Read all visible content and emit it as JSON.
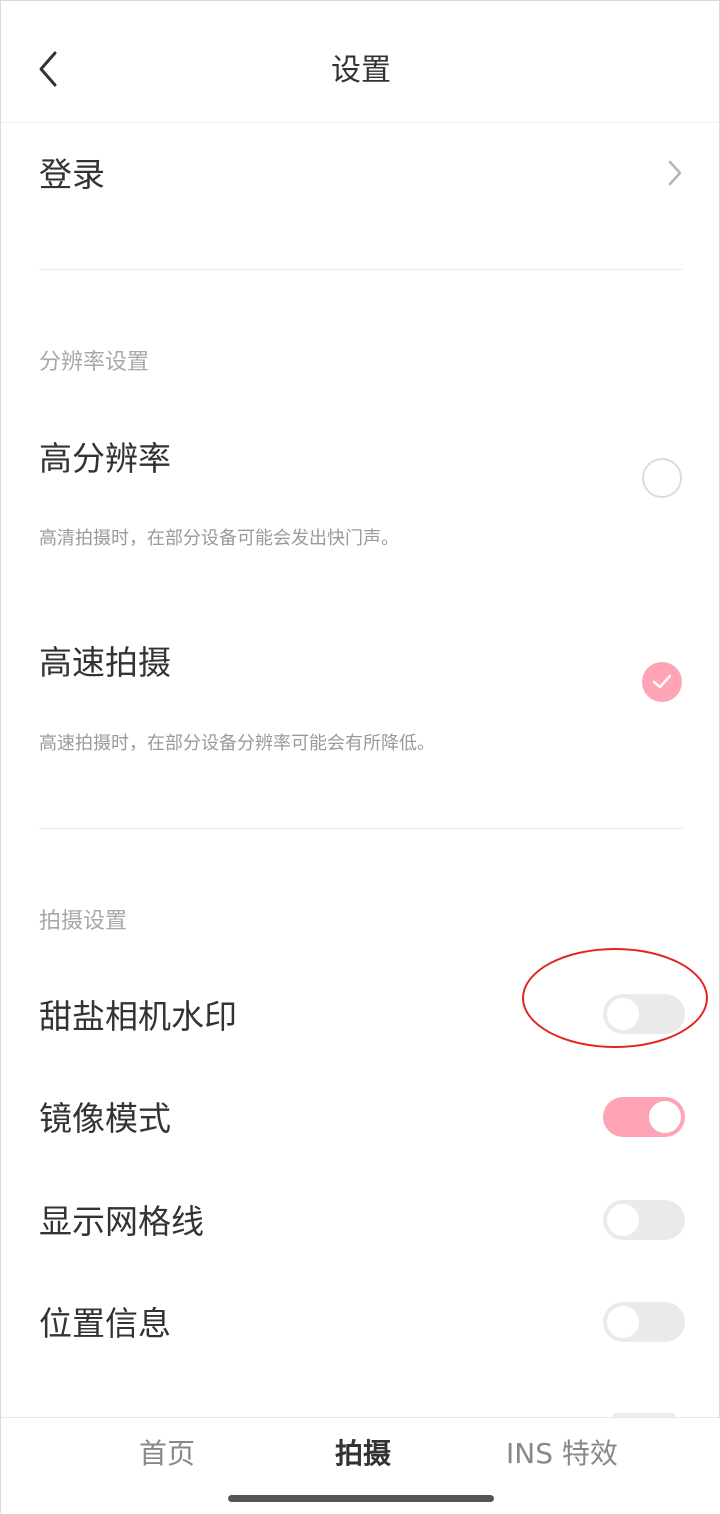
{
  "header": {
    "title": "设置"
  },
  "login": {
    "label": "登录"
  },
  "resolution": {
    "section_title": "分辨率设置",
    "options": [
      {
        "label": "高分辨率",
        "description": "高清拍摄时，在部分设备可能会发出快门声。",
        "selected": false
      },
      {
        "label": "高速拍摄",
        "description": "高速拍摄时，在部分设备分辨率可能会有所降低。",
        "selected": true
      }
    ]
  },
  "capture": {
    "section_title": "拍摄设置",
    "toggles": [
      {
        "label": "甜盐相机水印",
        "on": false
      },
      {
        "label": "镜像模式",
        "on": true
      },
      {
        "label": "显示网格线",
        "on": false
      },
      {
        "label": "位置信息",
        "on": false
      }
    ]
  },
  "tabbar": {
    "tabs": [
      {
        "label": "首页",
        "active": false
      },
      {
        "label": "拍摄",
        "active": true
      },
      {
        "label": "INS 特效",
        "active": false
      }
    ]
  },
  "colors": {
    "accent": "#ffa4b4",
    "annotation": "#e52222",
    "toggle_off": "#eaeaea"
  },
  "icons": {
    "back": "chevron-left-icon",
    "login_arrow": "chevron-right-icon",
    "check": "check-icon"
  }
}
